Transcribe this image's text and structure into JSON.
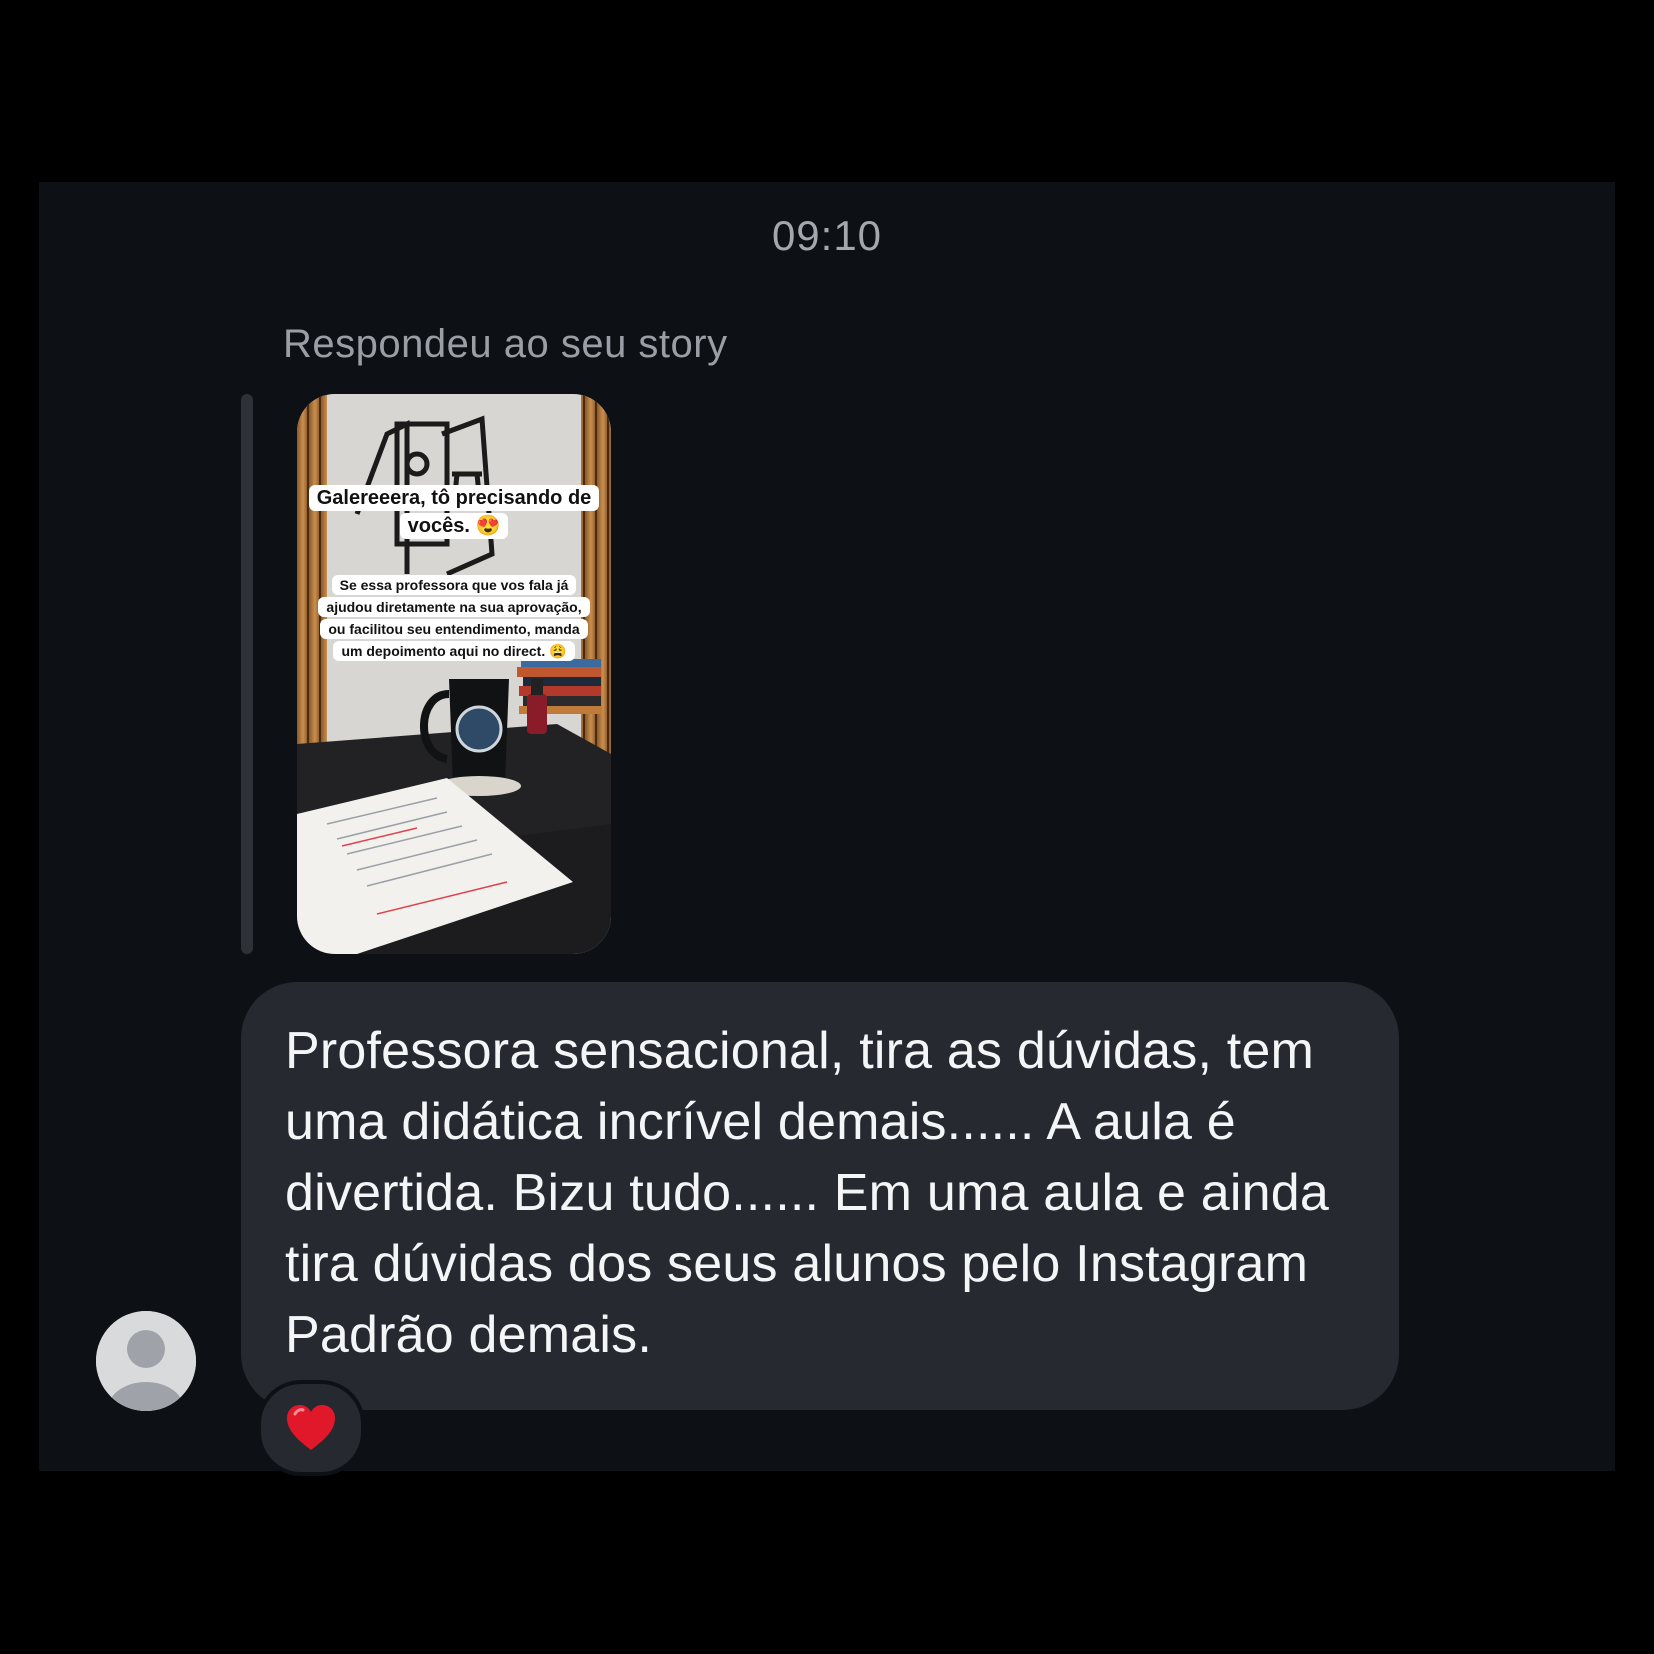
{
  "chat": {
    "timestamp": "09:10",
    "reply_context": "Respondeu ao seu story",
    "story": {
      "caption_title": "Galereeera, tô precisando de vocês. 😍",
      "caption_body": "Se essa professora que vos fala já ajudou diretamente na sua aprovação, ou facilitou seu entendimento, manda um depoimento aqui no direct. 😩"
    },
    "message": {
      "text": "Professora sensacional, tira as dúvidas, tem uma didática incrível demais...... A aula é divertida. Bizu tudo...... Em uma aula e ainda tira dúvidas dos seus alunos pelo Instagram Padrão demais.",
      "reaction": "heart"
    },
    "colors": {
      "panel_background": "#0d1116",
      "bubble_background": "#26292f",
      "reaction_heart": "#e0182a"
    }
  }
}
